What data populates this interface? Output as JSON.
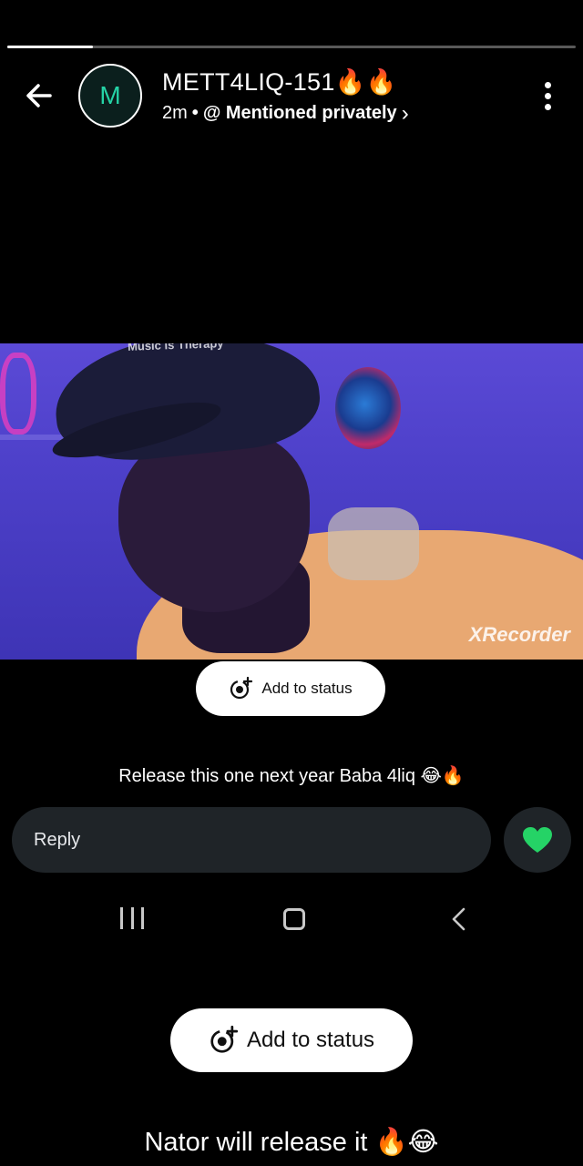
{
  "status": {
    "progress_fraction": 0.15
  },
  "header": {
    "avatar_initial": "M",
    "contact_name": "METT4LIQ-151🔥🔥",
    "time_ago": "2m",
    "separator": "•",
    "mention_label": "@ Mentioned privately",
    "chevron": "›"
  },
  "video": {
    "overlay_text": "Music is Therapy",
    "watermark": "XRecorder"
  },
  "add_to_status_small": {
    "label": "Add to status"
  },
  "caption_small": "Release this one  next year Baba 4liq 😂🔥",
  "reply": {
    "placeholder": "Reply"
  },
  "add_to_status_big": {
    "label": "Add to status"
  },
  "caption_big": "Nator will release it 🔥😂",
  "colors": {
    "accent_green": "#25d366",
    "avatar_text": "#25d3a6",
    "reply_bg": "#1f2428"
  },
  "icons": {
    "back": "arrow-left-icon",
    "menu": "more-vertical-icon",
    "add_status": "status-add-icon",
    "like": "heart-icon"
  }
}
